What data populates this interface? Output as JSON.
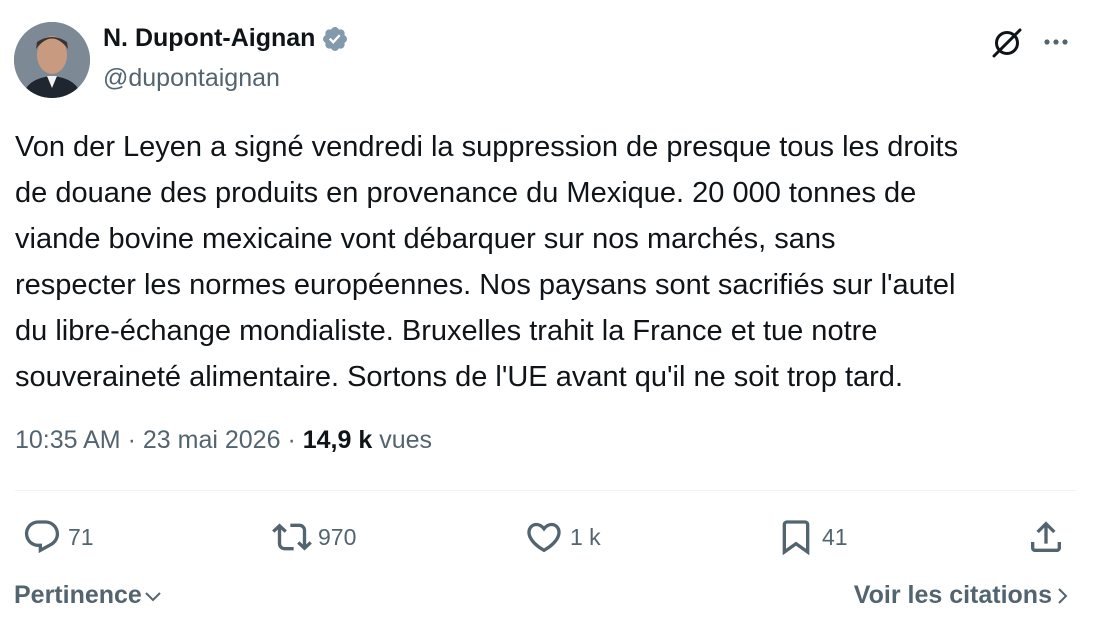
{
  "author": {
    "display_name": "N. Dupont-Aignan",
    "handle": "@dupontaignan",
    "verified_icon": "verified-badge-icon",
    "verified_color": "#829aab"
  },
  "tweet": {
    "lines": [
      "Von der Leyen a signé vendredi la suppression de presque tous les droits",
      "de douane des produits en provenance du Mexique. 20 000 tonnes de",
      "viande bovine mexicaine vont débarquer sur nos marchés, sans",
      "respecter les normes européennes. Nos paysans sont sacrifiés sur l'autel",
      "du libre-échange mondialiste. Bruxelles trahit la France et tue notre",
      "souveraineté alimentaire. Sortons de l'UE avant qu'il ne soit trop tard."
    ],
    "time": "10:35 AM",
    "separator": "·",
    "date": "23 mai 2026",
    "views_count": "14,9 k",
    "views_label": "vues"
  },
  "actions": {
    "replies": "71",
    "reposts": "970",
    "likes": "1 k",
    "bookmarks": "41"
  },
  "footer": {
    "sort_label": "Pertinence",
    "quotes_label": "Voir les citations"
  },
  "icons": {
    "grok": "grok-icon",
    "more": "more-icon",
    "reply": "reply-icon",
    "repost": "repost-icon",
    "like": "like-icon",
    "bookmark": "bookmark-icon",
    "share": "share-icon"
  },
  "colors": {
    "text_primary": "#0f1419",
    "text_secondary": "#536471",
    "divider": "#eff3f4"
  }
}
